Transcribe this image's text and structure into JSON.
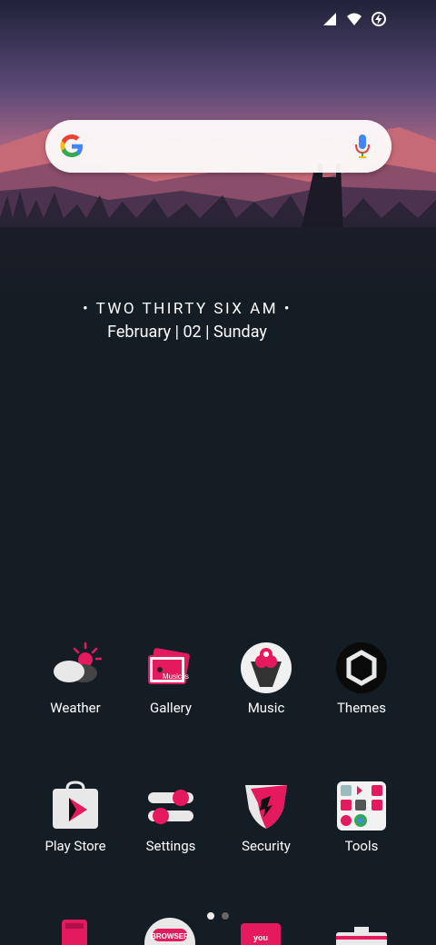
{
  "clock": {
    "time_words": "• TWO THIRTY SIX AM •",
    "date": "February | 02 | Sunday"
  },
  "apps_row1": [
    {
      "label": "Weather"
    },
    {
      "label": "Gallery"
    },
    {
      "label": "Music"
    },
    {
      "label": "Themes"
    }
  ],
  "apps_row2": [
    {
      "label": "Play Store"
    },
    {
      "label": "Settings"
    },
    {
      "label": "Security"
    },
    {
      "label": "Tools"
    }
  ],
  "icon_text": {
    "gallery": "Music is",
    "dock_browser": "BROWSER",
    "dock_youtube": "you"
  },
  "colors": {
    "accent": "#e5195e",
    "background": "#141d24"
  }
}
